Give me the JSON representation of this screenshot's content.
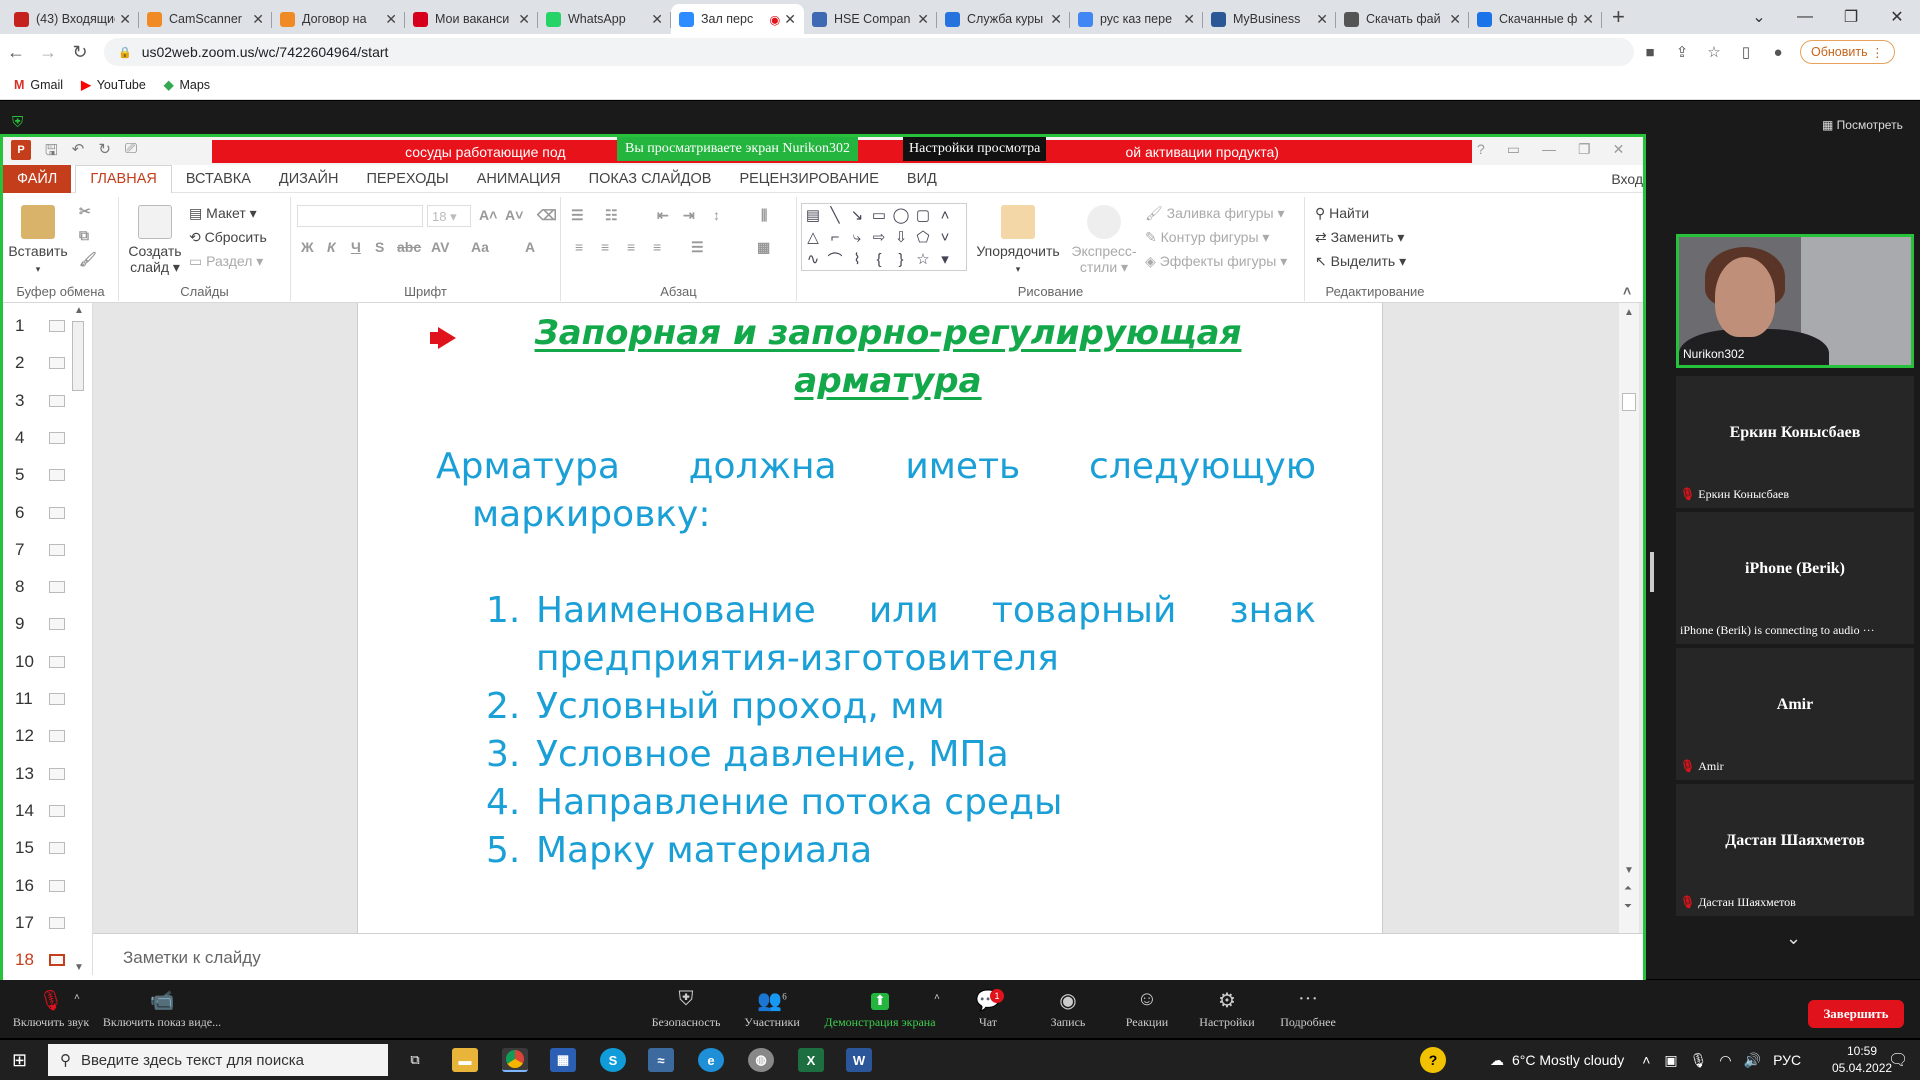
{
  "browser": {
    "tabs": [
      {
        "title": "(43) Входящие",
        "color": "#c5221f",
        "icon": "mail-icon"
      },
      {
        "title": "CamScanner",
        "color": "#f08a24",
        "icon": "camscanner-icon"
      },
      {
        "title": "Договор на",
        "color": "#f08a24",
        "icon": "camscanner-icon"
      },
      {
        "title": "Мои ваканси",
        "color": "#d6001c",
        "icon": "hh-icon"
      },
      {
        "title": "WhatsApp",
        "color": "#25d366",
        "icon": "whatsapp-icon"
      },
      {
        "title": "Зал перс",
        "color": "#2d8cff",
        "icon": "zoom-icon",
        "active": true
      },
      {
        "title": "HSE Compan",
        "color": "#3d6ab3",
        "icon": "hse-icon"
      },
      {
        "title": "Служба куры",
        "color": "#2673dd",
        "icon": "courier-icon"
      },
      {
        "title": "рус каз пере",
        "color": "#4285f4",
        "icon": "google-icon"
      },
      {
        "title": "MyBusiness",
        "color": "#2b5797",
        "icon": "mybusiness-icon"
      },
      {
        "title": "Скачать фай",
        "color": "#555555",
        "icon": "globe-icon"
      },
      {
        "title": "Скачанные ф",
        "color": "#1a73e8",
        "icon": "download-icon"
      }
    ],
    "url": "us02web.zoom.us/wc/7422604964/start",
    "update_label": "Обновить",
    "bookmarks": [
      "Gmail",
      "YouTube",
      "Maps"
    ]
  },
  "zoom": {
    "view_options": "Посмотреть",
    "share_banner": "Вы просматриваете экран Nurikon302",
    "share_settings": "Настройки просмотра",
    "participants": [
      {
        "name": "Еркин Конысбаев",
        "label": "Еркин Конысбаев"
      },
      {
        "name": "iPhone (Berik)",
        "label": "iPhone (Berik) is connecting to audio ···"
      },
      {
        "name": "Amir",
        "label": "Amir"
      },
      {
        "name": "Дастан Шаяхметов",
        "label": "Дастан Шаяхметов"
      }
    ],
    "video_label": "Nurikon302",
    "toolbar": {
      "mute": "Включить звук",
      "video": "Включить показ виде...",
      "security": "Безопасность",
      "participants": "Участники",
      "participants_count": "6",
      "share": "Демонстрация экрана",
      "chat": "Чат",
      "chat_badge": "1",
      "record": "Запись",
      "reactions": "Реакции",
      "settings": "Настройки",
      "more": "Подробнее",
      "end": "Завершить"
    }
  },
  "ppt": {
    "banner_left": "сосуды работающие под",
    "banner_right": "ой активации продукта)",
    "tabs": [
      "ФАЙЛ",
      "ГЛАВНАЯ",
      "ВСТАВКА",
      "ДИЗАЙН",
      "ПЕРЕХОДЫ",
      "АНИМАЦИЯ",
      "ПОКАЗ СЛАЙДОВ",
      "РЕЦЕНЗИРОВАНИЕ",
      "ВИД"
    ],
    "login": "Вход",
    "ribbon": {
      "paste": "Вставить",
      "clipboard": "Буфер обмена",
      "layout": "Макет",
      "reset": "Сбросить",
      "section": "Раздел",
      "new_slide_1": "Создать",
      "new_slide_2": "слайд",
      "slides": "Слайды",
      "font": "Шрифт",
      "font_size": "18",
      "paragraph": "Абзац",
      "arrange": "Упорядочить",
      "styles_1": "Экспресс-",
      "styles_2": "стили",
      "fill": "Заливка фигуры",
      "outline": "Контур фигуры",
      "effects": "Эффекты фигуры",
      "drawing": "Рисование",
      "find": "Найти",
      "replace": "Заменить",
      "select": "Выделить",
      "editing": "Редактирование"
    },
    "slide_numbers": [
      "1",
      "2",
      "3",
      "4",
      "5",
      "6",
      "7",
      "8",
      "9",
      "10",
      "11",
      "12",
      "13",
      "14",
      "15",
      "16",
      "17",
      "18"
    ],
    "slide": {
      "title": "Запорная и запорно-регулирующая арматура",
      "intro_line1": "Арматура должна иметь следующую",
      "intro_line2": "маркировку:",
      "items": [
        "Наименование или товарный знак предприятия-изготовителя",
        "Условный проход, мм",
        "Условное давление, МПа",
        "Направление потока среды",
        "Марку материала"
      ]
    },
    "notes_placeholder": "Заметки к слайду"
  },
  "taskbar": {
    "search_placeholder": "Введите здесь текст для поиска",
    "weather": "6°C  Mostly cloudy",
    "lang": "РУС",
    "time": "10:59",
    "date": "05.04.2022"
  }
}
